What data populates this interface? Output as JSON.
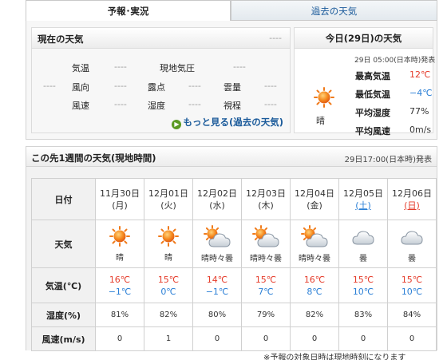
{
  "tabs": {
    "forecast": "予報･実況",
    "past": "過去の天気"
  },
  "current": {
    "title": "現在の天気",
    "dash": "----",
    "labels": {
      "kion": "気温",
      "kiatsu": "現地気圧",
      "fuukou": "風向",
      "tenten": "露点",
      "unryou": "雲量",
      "fuusoku": "風速",
      "shitsudo": "湿度",
      "shikai": "視程"
    },
    "value": "----",
    "more_link": "もっと見る(過去の天気)"
  },
  "today": {
    "title": "今日(29日)の天気",
    "observed": "29日 05:00(日本時)発表",
    "high_label": "最高気温",
    "high": "12℃",
    "low_label": "最低気温",
    "low": "−4℃",
    "humid_label": "平均湿度",
    "humid": "77%",
    "wind_label": "平均風速",
    "wind": "0m/s",
    "weather": "晴",
    "icon": "sun-icon"
  },
  "week": {
    "title": "この先1週間の天気(現地時間)",
    "issued": "29日17:00(日本時)発表",
    "row_labels": {
      "date": "日付",
      "weather": "天気",
      "temp": "気温(℃)",
      "humid": "湿度(%)",
      "wind": "風速(m/s)"
    },
    "days": [
      {
        "date": "11月30日",
        "dow": "(月)",
        "dow_type": "weekday",
        "icon": "sun-icon",
        "weather": "晴",
        "high": "16℃",
        "low": "−1℃",
        "humid": "81%",
        "wind": "0"
      },
      {
        "date": "12月01日",
        "dow": "(火)",
        "dow_type": "weekday",
        "icon": "sun-icon",
        "weather": "晴",
        "high": "15℃",
        "low": "0℃",
        "humid": "82%",
        "wind": "1"
      },
      {
        "date": "12月02日",
        "dow": "(水)",
        "dow_type": "weekday",
        "icon": "sun-cloud-icon",
        "weather": "晴時々曇",
        "high": "14℃",
        "low": "−1℃",
        "humid": "80%",
        "wind": "0"
      },
      {
        "date": "12月03日",
        "dow": "(木)",
        "dow_type": "weekday",
        "icon": "sun-cloud-icon",
        "weather": "晴時々曇",
        "high": "15℃",
        "low": "7℃",
        "humid": "79%",
        "wind": "0"
      },
      {
        "date": "12月04日",
        "dow": "(金)",
        "dow_type": "weekday",
        "icon": "sun-cloud-icon",
        "weather": "晴時々曇",
        "high": "16℃",
        "low": "8℃",
        "humid": "82%",
        "wind": "0"
      },
      {
        "date": "12月05日",
        "dow": "(土)",
        "dow_type": "saturday",
        "icon": "cloud-icon",
        "weather": "曇",
        "high": "15℃",
        "low": "10℃",
        "humid": "83%",
        "wind": "0"
      },
      {
        "date": "12月06日",
        "dow": "(日)",
        "dow_type": "sunday",
        "icon": "cloud-icon",
        "weather": "曇",
        "high": "15℃",
        "low": "10℃",
        "humid": "84%",
        "wind": "0"
      }
    ]
  },
  "note": "※予報の対象日時は現地時刻になります",
  "colors": {
    "high": "#e53b2a",
    "low": "#2a7fd6",
    "saturday": "#2a7fd6",
    "sunday": "#e53b2a",
    "link": "#1a5a9a"
  }
}
